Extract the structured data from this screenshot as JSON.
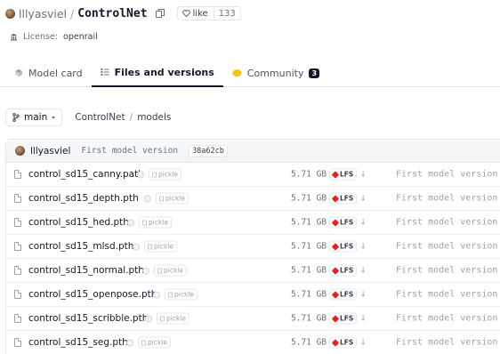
{
  "header": {
    "owner": "lllyasviel",
    "separator": "/",
    "repo": "ControlNet",
    "like_label": "like",
    "like_count": "133"
  },
  "license": {
    "label": "License:",
    "value": "openrail"
  },
  "tabs": [
    {
      "label": "Model card",
      "icon": "model-card-icon",
      "active": false
    },
    {
      "label": "Files and versions",
      "icon": "files-icon",
      "active": true
    },
    {
      "label": "Community",
      "icon": "community-icon",
      "badge": "3",
      "active": false
    }
  ],
  "branch": {
    "name": "main",
    "path": [
      "ControlNet",
      "models"
    ],
    "path_separator": "/"
  },
  "last_commit": {
    "user": "lllyasviel",
    "message": "First model version",
    "hash": "38a62cb"
  },
  "files": [
    {
      "name": "control_sd15_canny.path",
      "badge": "pickle",
      "size": "5.71 GB",
      "lfs": "LFS",
      "commit": "First model version"
    },
    {
      "name": "control_sd15_depth.pth",
      "badge": "pickle",
      "size": "5.71 GB",
      "lfs": "LFS",
      "commit": "First model version"
    },
    {
      "name": "control_sd15_hed.pth",
      "badge": "pickle",
      "size": "5.71 GB",
      "lfs": "LFS",
      "commit": "First model version"
    },
    {
      "name": "control_sd15_mlsd.pth",
      "badge": "pickle",
      "size": "5.71 GB",
      "lfs": "LFS",
      "commit": "First model version"
    },
    {
      "name": "control_sd15_normal.pth",
      "badge": "pickle",
      "size": "5.71 GB",
      "lfs": "LFS",
      "commit": "First model version"
    },
    {
      "name": "control_sd15_openpose.pth",
      "badge": "pickle",
      "size": "5.71 GB",
      "lfs": "LFS",
      "commit": "First model version"
    },
    {
      "name": "control_sd15_scribble.pth",
      "badge": "pickle",
      "size": "5.71 GB",
      "lfs": "LFS",
      "commit": "First model version"
    },
    {
      "name": "control_sd15_seg.pth",
      "badge": "pickle",
      "size": "5.71 GB",
      "lfs": "LFS",
      "commit": "First model version"
    }
  ],
  "colors": {
    "lfs_accent": "#dc2626",
    "text_primary": "#111827",
    "text_muted": "#9ca3af"
  }
}
